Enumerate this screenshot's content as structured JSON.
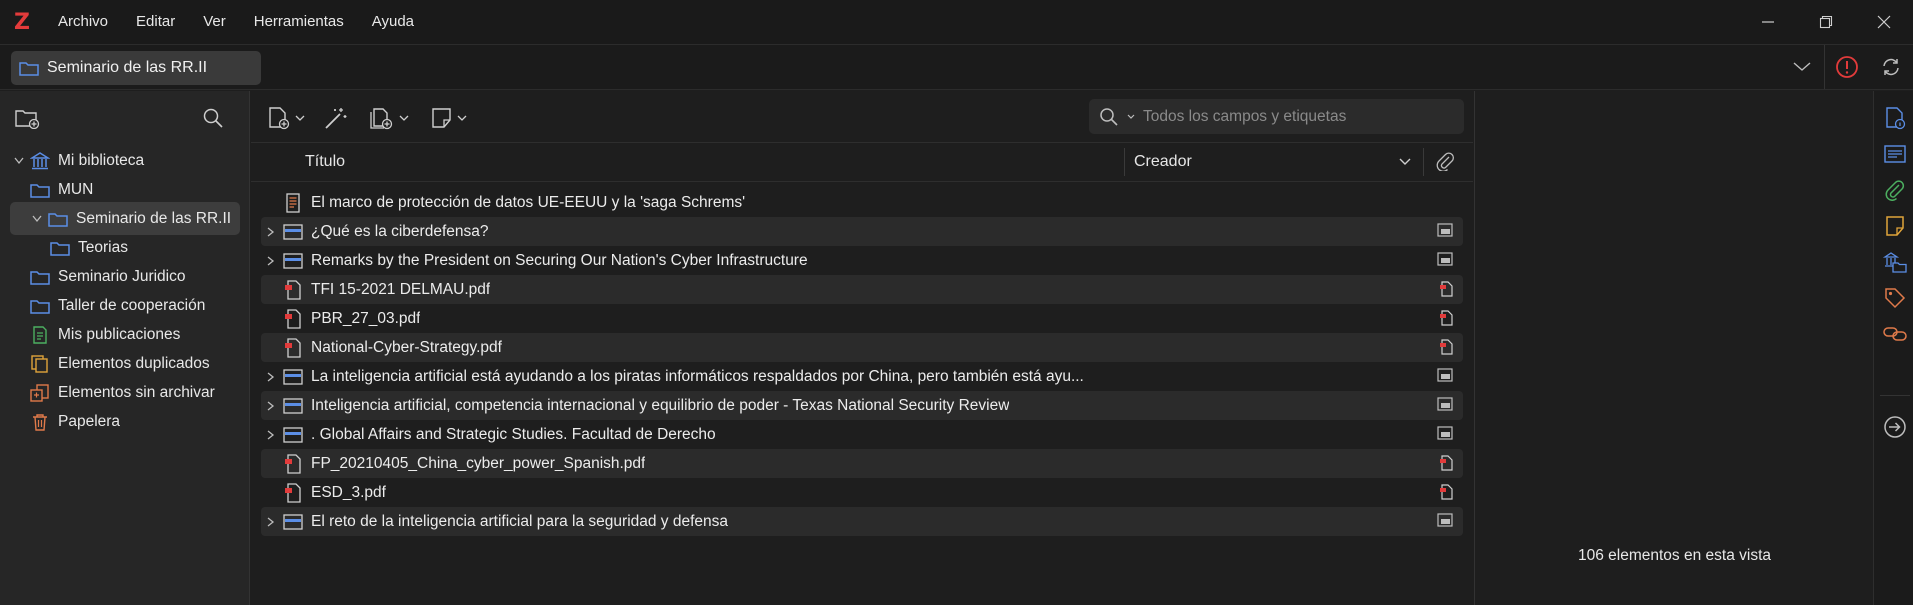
{
  "app": {
    "logo_letter": "Z",
    "menu": [
      "Archivo",
      "Editar",
      "Ver",
      "Herramientas",
      "Ayuda"
    ]
  },
  "tab": {
    "label": "Seminario de las RR.II"
  },
  "colors": {
    "accent_red": "#e23b3b",
    "folder_blue": "#5b8ee6",
    "selected_bg": "#3d3d3d"
  },
  "collections": [
    {
      "label": "Mi biblioteca",
      "icon": "library-icon",
      "expanded": true
    },
    {
      "label": "MUN",
      "icon": "folder-icon"
    },
    {
      "label": "Seminario de las RR.II",
      "icon": "folder-icon",
      "expanded": true,
      "selected": true
    },
    {
      "label": "Teorias",
      "icon": "folder-icon"
    },
    {
      "label": "Seminario Juridico",
      "icon": "folder-icon"
    },
    {
      "label": "Taller de cooperación",
      "icon": "folder-icon"
    },
    {
      "label": "Mis publicaciones",
      "icon": "publications-icon"
    },
    {
      "label": "Elementos duplicados",
      "icon": "duplicates-icon"
    },
    {
      "label": "Elementos sin archivar",
      "icon": "unfiled-icon"
    },
    {
      "label": "Papelera",
      "icon": "trash-icon"
    }
  ],
  "search": {
    "placeholder": "Todos los campos y etiquetas"
  },
  "columns": {
    "title": "Título",
    "creator": "Creador"
  },
  "items": [
    {
      "title": "El marco de protección de datos UE-EEUU y la 'saga Schrems'",
      "type": "report",
      "expandable": false,
      "attachment": ""
    },
    {
      "title": "¿Qué es la ciberdefensa?",
      "type": "webpage",
      "expandable": true,
      "attachment": "snapshot"
    },
    {
      "title": "Remarks by the President on Securing Our Nation's Cyber Infrastructure",
      "type": "webpage",
      "expandable": true,
      "attachment": "snapshot"
    },
    {
      "title": "TFI 15-2021 DELMAU.pdf",
      "type": "pdf",
      "expandable": false,
      "attachment": "pdf"
    },
    {
      "title": "PBR_27_03.pdf",
      "type": "pdf",
      "expandable": false,
      "attachment": "pdf"
    },
    {
      "title": "National-Cyber-Strategy.pdf",
      "type": "pdf",
      "expandable": false,
      "attachment": "pdf"
    },
    {
      "title": "La inteligencia artificial está ayudando a los piratas informáticos respaldados por China, pero también está ayu...",
      "type": "webpage",
      "expandable": true,
      "attachment": "snapshot"
    },
    {
      "title": "Inteligencia artificial, competencia internacional y equilibrio de poder - Texas National Security Review",
      "type": "webpage",
      "expandable": true,
      "attachment": "snapshot"
    },
    {
      "title": ". Global Affairs and Strategic Studies. Facultad de Derecho",
      "type": "webpage",
      "expandable": true,
      "attachment": "snapshot"
    },
    {
      "title": "FP_20210405_China_cyber_power_Spanish.pdf",
      "type": "pdf",
      "expandable": false,
      "attachment": "pdf"
    },
    {
      "title": "ESD_3.pdf",
      "type": "pdf",
      "expandable": false,
      "attachment": "pdf"
    },
    {
      "title": "El reto de la inteligencia artificial para la seguridad y defensa",
      "type": "webpage",
      "expandable": true,
      "attachment": "snapshot"
    }
  ],
  "right": {
    "count_text": "106 elementos en esta vista"
  }
}
